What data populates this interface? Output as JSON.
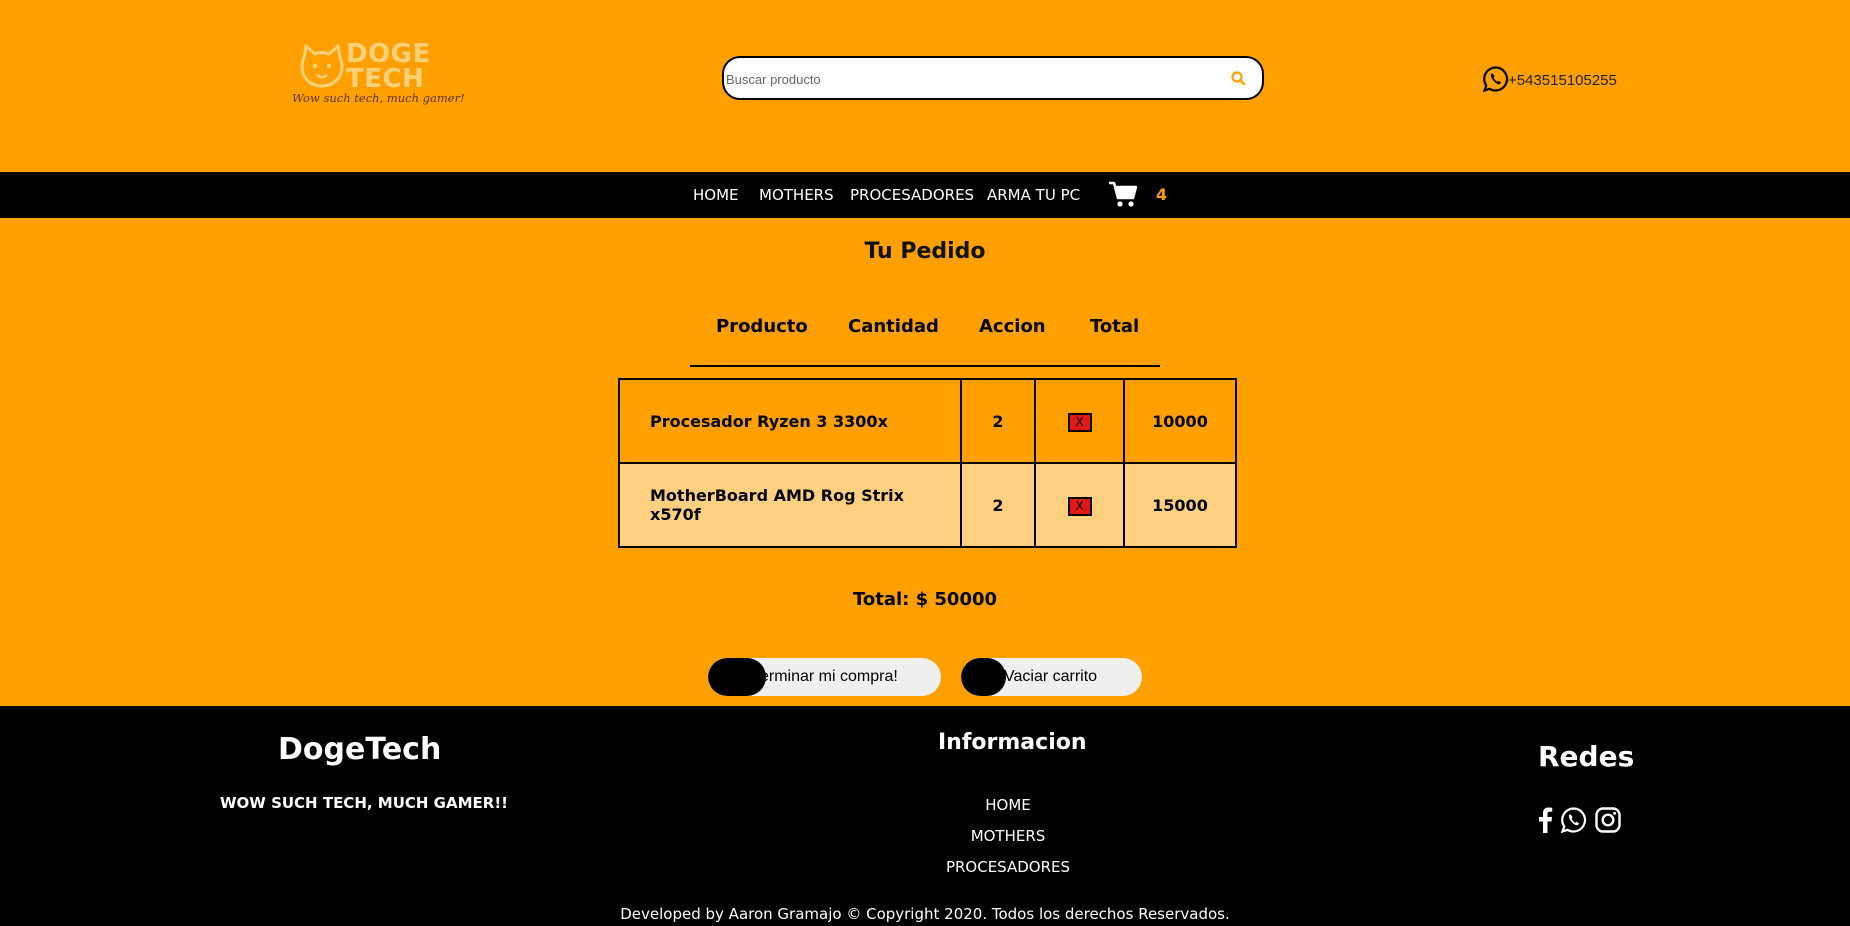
{
  "header": {
    "logo": {
      "brand_line1": "DOGE",
      "brand_line2": "TECH",
      "tagline": "Wow such tech, much gamer!"
    },
    "search": {
      "placeholder": "Buscar producto",
      "value": ""
    },
    "phone": "+543515105255"
  },
  "nav": {
    "items": [
      "HOME",
      "MOTHERS",
      "PROCESADORES",
      "ARMA TU PC"
    ],
    "cart_count": "4"
  },
  "main": {
    "title": "Tu Pedido",
    "columns": [
      "Producto",
      "Cantidad",
      "Accion",
      "Total"
    ],
    "rows": [
      {
        "product": "Procesador Ryzen 3 3300x",
        "qty": "2",
        "action": "X",
        "total": "10000"
      },
      {
        "product": "MotherBoard AMD Rog Strix x570f",
        "qty": "2",
        "action": "X",
        "total": "15000"
      }
    ],
    "grand_total": "Total: $ 50000",
    "buttons": {
      "checkout": "Terminar mi compra!",
      "empty": "Vaciar carrito"
    }
  },
  "footer": {
    "brand": "DogeTech",
    "slogan": "WOW SUCH TECH, MUCH GAMER!!",
    "info_title": "Informacion",
    "info_links": [
      "HOME",
      "MOTHERS",
      "PROCESADORES"
    ],
    "social_title": "Redes",
    "social_icons": [
      "facebook-icon",
      "whatsapp-icon",
      "instagram-icon"
    ],
    "copyright": "Developed by Aaron Gramajo © Copyright 2020. Todos los derechos Reservados."
  },
  "colors": {
    "background": "#ffa000",
    "bar": "#000000",
    "row_alt": "#ffd080",
    "remove_button": "#e01818"
  }
}
